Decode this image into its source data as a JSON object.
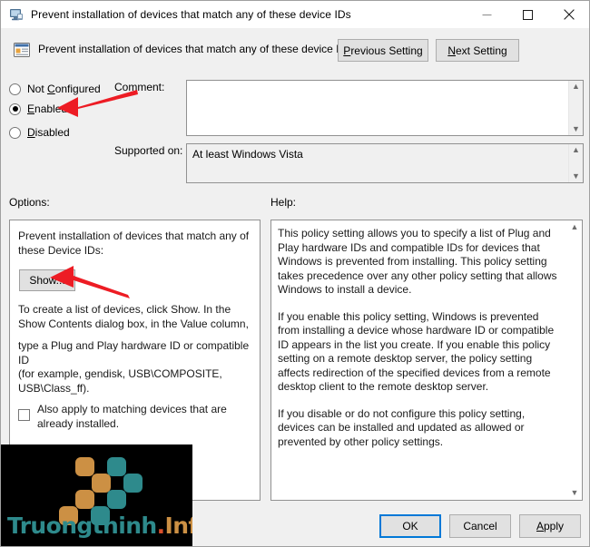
{
  "window": {
    "title": "Prevent installation of devices that match any of these device IDs",
    "title_icon": "computer-monitor-icon",
    "minimize_label": "Minimize",
    "maximize_label": "Maximize",
    "close_label": "Close"
  },
  "policy_header": {
    "icon": "group-policy-setting-icon",
    "name": "Prevent installation of devices that match any of these device IDs",
    "previous_button": "Previous Setting",
    "previous_accel": "P",
    "next_button": "Next Setting",
    "next_accel": "N"
  },
  "state": {
    "options": [
      {
        "label": "Not Configured",
        "accel": "C",
        "selected": false
      },
      {
        "label": "Enabled",
        "accel": "E",
        "selected": true
      },
      {
        "label": "Disabled",
        "accel": "D",
        "selected": false
      }
    ],
    "comment_label": "Comment:",
    "comment_value": "",
    "supported_label": "Supported on:",
    "supported_value": "At least Windows Vista"
  },
  "panels": {
    "options_label": "Options:",
    "help_label": "Help:"
  },
  "options_panel": {
    "heading": "Prevent installation of devices that match any of these Device IDs:",
    "show_button": "Show...",
    "line_2": "To create a list of devices, click Show. In the Show Contents dialog box, in the Value column,",
    "line_3": "type a Plug and Play hardware ID or compatible ID",
    "line_4": "(for example, gendisk, USB\\COMPOSITE, USB\\Class_ff).",
    "checkbox_label": "Also apply to matching devices that are already installed.",
    "checkbox_checked": false
  },
  "help_panel": {
    "paragraphs": [
      "This policy setting allows you to specify a list of Plug and Play hardware IDs and compatible IDs for devices that Windows is prevented from installing. This policy setting takes precedence over any other policy setting that allows Windows to install a device.",
      "If you enable this policy setting, Windows is prevented from installing a device whose hardware ID or compatible ID appears in the list you create. If you enable this policy setting on a remote desktop server, the policy setting affects redirection of the specified devices from a remote desktop client to the remote desktop server.",
      "If you disable or do not configure this policy setting, devices can be installed and updated as allowed or prevented by other policy settings."
    ]
  },
  "footer": {
    "ok": "OK",
    "cancel": "Cancel",
    "apply": "Apply",
    "apply_accel": "A"
  },
  "annotations": {
    "arrow_enabled": "red-arrow-pointing-to-enabled",
    "arrow_show": "red-arrow-pointing-to-show-button"
  },
  "watermark": {
    "text_main": "Truongthinh",
    "text_dot": ".",
    "text_suffix": "Info",
    "color_orange": "#cc9044",
    "color_teal": "#2e8a8c",
    "color_dot": "#d94f2b"
  }
}
